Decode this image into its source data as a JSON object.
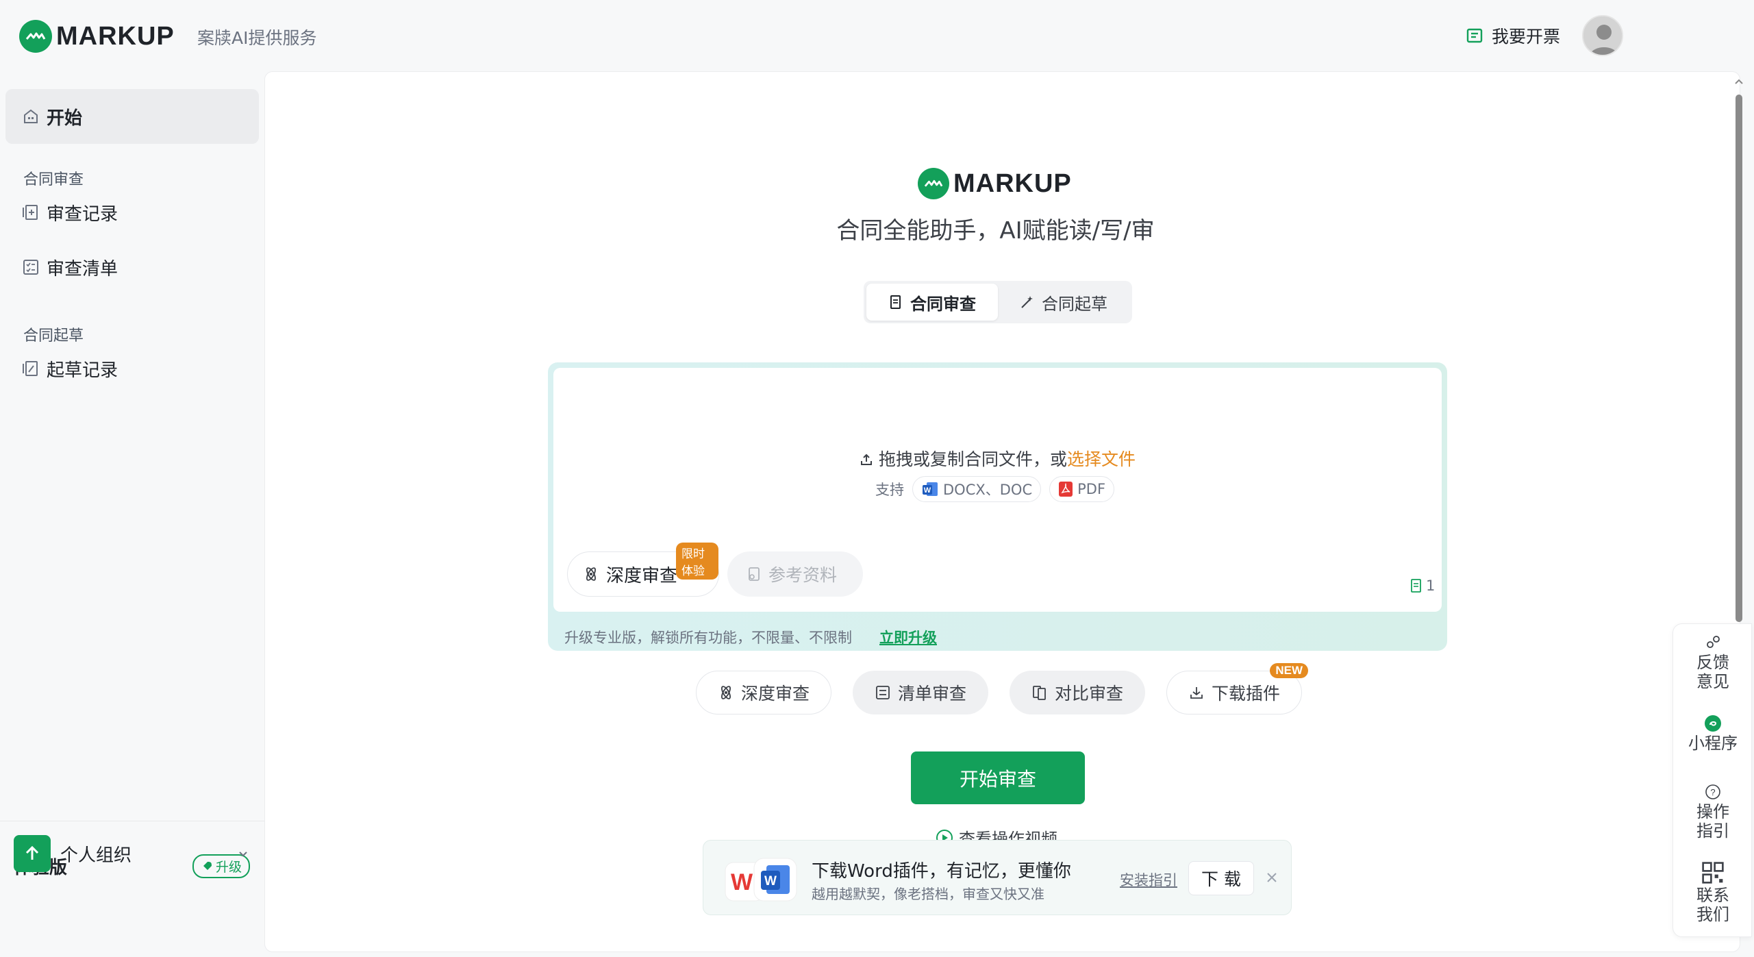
{
  "header": {
    "brand": "MARKUP",
    "provider": "案牍AI提供服务",
    "invoice_label": "我要开票"
  },
  "sidebar": {
    "start_label": "开始",
    "section_review": "合同审查",
    "review_items": [
      {
        "label": "审查记录",
        "icon": "review-record-icon"
      },
      {
        "label": "审查清单",
        "icon": "checklist-icon"
      }
    ],
    "section_draft": "合同起草",
    "draft_items": [
      {
        "label": "起草记录",
        "icon": "draft-record-icon"
      }
    ],
    "plan_label": "体验版",
    "upgrade_label": "升级",
    "org_label": "个人组织"
  },
  "main": {
    "brand": "MARKUP",
    "tagline": "合同全能助手，AI赋能读/写/审",
    "tabs": [
      {
        "label": "合同审查",
        "active": true
      },
      {
        "label": "合同起草",
        "active": false
      }
    ],
    "upload": {
      "hint_prefix": "拖拽或复制合同文件，或",
      "hint_link": "选择文件",
      "support_label": "支持",
      "formats": [
        "DOCX、DOC",
        "PDF"
      ],
      "deep_review_label": "深度审查",
      "limited_tag": "限时体验",
      "reference_label": "参考资料",
      "doc_count": "1",
      "upgrade_text": "升级专业版，解锁所有功能，不限量、不限制",
      "upgrade_link": "立即升级"
    },
    "functions": [
      {
        "label": "深度审查",
        "style": "outline"
      },
      {
        "label": "清单审查",
        "style": "filled"
      },
      {
        "label": "对比审查",
        "style": "filled"
      },
      {
        "label": "下载插件",
        "style": "outline",
        "tag": "NEW"
      }
    ],
    "start_button": "开始审查",
    "video_link": "查看操作视频",
    "plugin_banner": {
      "title": "下载Word插件，有记忆，更懂你",
      "subtitle": "越用越默契，像老搭档，审查又快又准",
      "guide_label": "安装指引",
      "download_label": "下 载"
    }
  },
  "float_toolbar": [
    {
      "label": "反馈\n意见",
      "icon": "feedback-icon"
    },
    {
      "label": "小程序",
      "icon": "miniprogram-icon"
    },
    {
      "label": "操作\n指引",
      "icon": "help-icon"
    },
    {
      "label": "联系\n我们",
      "icon": "qrcode-icon"
    }
  ],
  "colors": {
    "brand_green": "#13a05a",
    "accent_orange": "#e58a1f"
  }
}
